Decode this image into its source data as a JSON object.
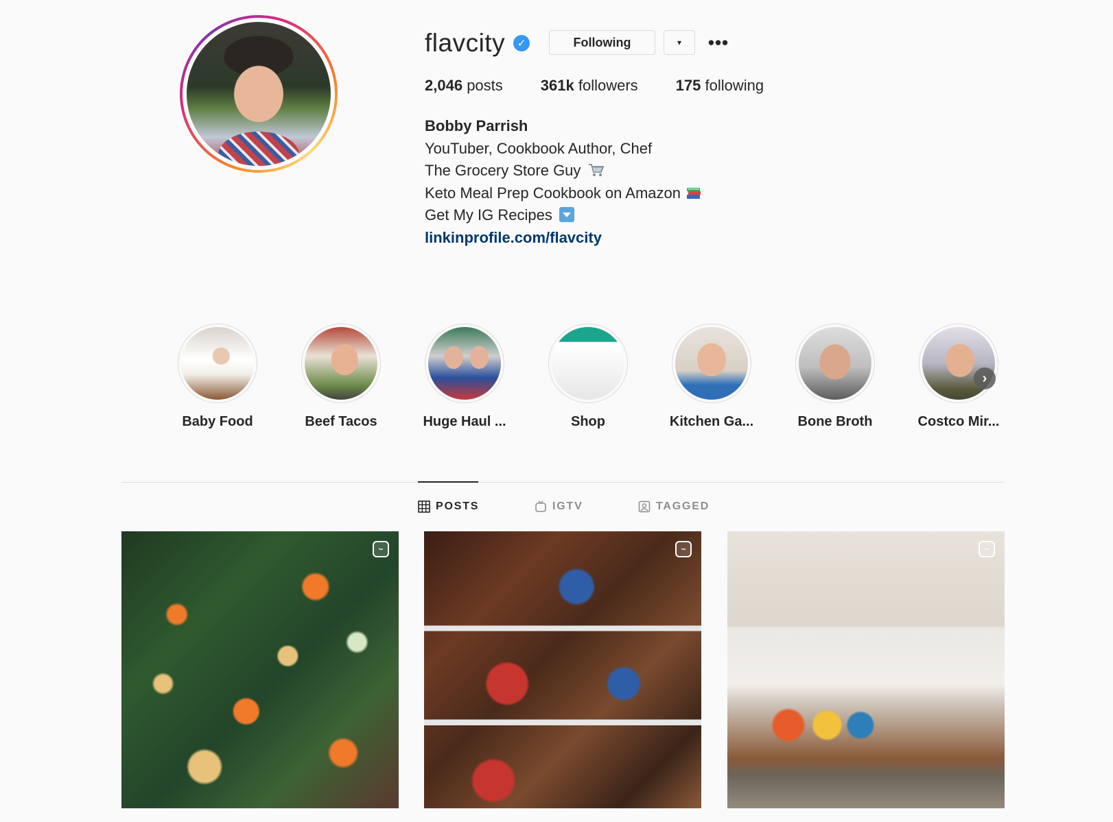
{
  "profile": {
    "username": "flavcity",
    "verified_icon": "verified-badge-icon",
    "following_label": "Following",
    "dropdown_icon": "▾",
    "more_icon": "•••"
  },
  "stats": {
    "posts_count": "2,046",
    "posts_label": "posts",
    "followers_count": "361k",
    "followers_label": "followers",
    "following_count": "175",
    "following_label": "following"
  },
  "bio": {
    "name": "Bobby Parrish",
    "lines": [
      "YouTuber, Cookbook Author, Chef",
      "The Grocery Store Guy",
      "Keto Meal Prep Cookbook on Amazon",
      "Get My IG Recipes"
    ],
    "emojis": [
      "shopping-cart-icon",
      "books-icon",
      "down-arrow-icon"
    ],
    "link": "linkinprofile.com/flavcity"
  },
  "highlights": [
    {
      "label": "Baby Food"
    },
    {
      "label": "Beef Tacos"
    },
    {
      "label": "Huge Haul ..."
    },
    {
      "label": "Shop"
    },
    {
      "label": "Kitchen Ga..."
    },
    {
      "label": "Bone Broth"
    },
    {
      "label": "Costco Mir..."
    }
  ],
  "tabs": [
    {
      "label": "POSTS",
      "active": true
    },
    {
      "label": "IGTV",
      "active": false
    },
    {
      "label": "TAGGED",
      "active": false
    }
  ],
  "colors": {
    "background": "#fafafa",
    "text": "#262626",
    "link": "#00376b",
    "verified": "#3897f0",
    "muted": "#8e8e8e",
    "border": "#dbdbdb"
  }
}
